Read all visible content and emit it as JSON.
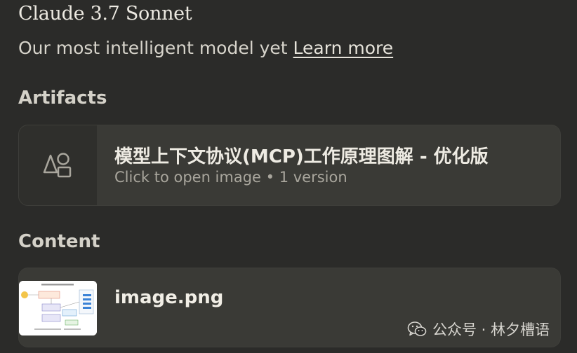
{
  "model": {
    "name": "Claude 3.7 Sonnet",
    "description": "Our most intelligent model yet",
    "learn_more": "Learn more"
  },
  "artifacts": {
    "heading": "Artifacts",
    "card": {
      "icon": "shapes-icon",
      "title": "模型上下文协议(MCP)工作原理图解 - 优化版",
      "subtitle": "Click to open image • 1 version"
    }
  },
  "content": {
    "heading": "Content",
    "card": {
      "filename": "image.png"
    }
  },
  "watermark": {
    "text": "公众号 · 林夕槽语",
    "logo": "wechat-logo-icon"
  }
}
